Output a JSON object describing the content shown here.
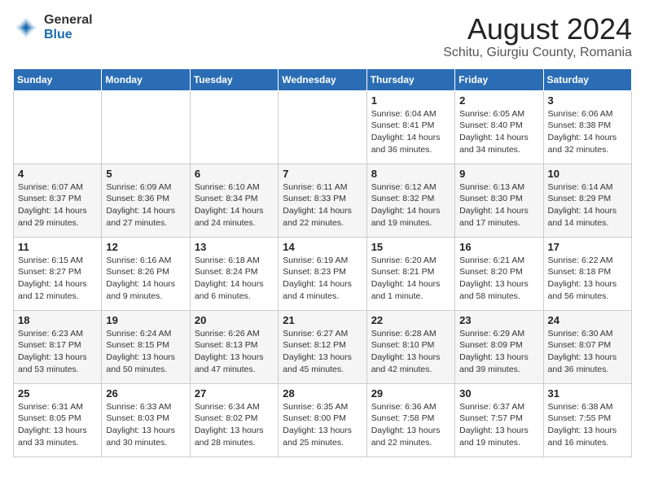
{
  "logo": {
    "general": "General",
    "blue": "Blue"
  },
  "title": "August 2024",
  "subtitle": "Schitu, Giurgiu County, Romania",
  "weekdays": [
    "Sunday",
    "Monday",
    "Tuesday",
    "Wednesday",
    "Thursday",
    "Friday",
    "Saturday"
  ],
  "weeks": [
    [
      {
        "day": "",
        "info": ""
      },
      {
        "day": "",
        "info": ""
      },
      {
        "day": "",
        "info": ""
      },
      {
        "day": "",
        "info": ""
      },
      {
        "day": "1",
        "info": "Sunrise: 6:04 AM\nSunset: 8:41 PM\nDaylight: 14 hours\nand 36 minutes."
      },
      {
        "day": "2",
        "info": "Sunrise: 6:05 AM\nSunset: 8:40 PM\nDaylight: 14 hours\nand 34 minutes."
      },
      {
        "day": "3",
        "info": "Sunrise: 6:06 AM\nSunset: 8:38 PM\nDaylight: 14 hours\nand 32 minutes."
      }
    ],
    [
      {
        "day": "4",
        "info": "Sunrise: 6:07 AM\nSunset: 8:37 PM\nDaylight: 14 hours\nand 29 minutes."
      },
      {
        "day": "5",
        "info": "Sunrise: 6:09 AM\nSunset: 8:36 PM\nDaylight: 14 hours\nand 27 minutes."
      },
      {
        "day": "6",
        "info": "Sunrise: 6:10 AM\nSunset: 8:34 PM\nDaylight: 14 hours\nand 24 minutes."
      },
      {
        "day": "7",
        "info": "Sunrise: 6:11 AM\nSunset: 8:33 PM\nDaylight: 14 hours\nand 22 minutes."
      },
      {
        "day": "8",
        "info": "Sunrise: 6:12 AM\nSunset: 8:32 PM\nDaylight: 14 hours\nand 19 minutes."
      },
      {
        "day": "9",
        "info": "Sunrise: 6:13 AM\nSunset: 8:30 PM\nDaylight: 14 hours\nand 17 minutes."
      },
      {
        "day": "10",
        "info": "Sunrise: 6:14 AM\nSunset: 8:29 PM\nDaylight: 14 hours\nand 14 minutes."
      }
    ],
    [
      {
        "day": "11",
        "info": "Sunrise: 6:15 AM\nSunset: 8:27 PM\nDaylight: 14 hours\nand 12 minutes."
      },
      {
        "day": "12",
        "info": "Sunrise: 6:16 AM\nSunset: 8:26 PM\nDaylight: 14 hours\nand 9 minutes."
      },
      {
        "day": "13",
        "info": "Sunrise: 6:18 AM\nSunset: 8:24 PM\nDaylight: 14 hours\nand 6 minutes."
      },
      {
        "day": "14",
        "info": "Sunrise: 6:19 AM\nSunset: 8:23 PM\nDaylight: 14 hours\nand 4 minutes."
      },
      {
        "day": "15",
        "info": "Sunrise: 6:20 AM\nSunset: 8:21 PM\nDaylight: 14 hours\nand 1 minute."
      },
      {
        "day": "16",
        "info": "Sunrise: 6:21 AM\nSunset: 8:20 PM\nDaylight: 13 hours\nand 58 minutes."
      },
      {
        "day": "17",
        "info": "Sunrise: 6:22 AM\nSunset: 8:18 PM\nDaylight: 13 hours\nand 56 minutes."
      }
    ],
    [
      {
        "day": "18",
        "info": "Sunrise: 6:23 AM\nSunset: 8:17 PM\nDaylight: 13 hours\nand 53 minutes."
      },
      {
        "day": "19",
        "info": "Sunrise: 6:24 AM\nSunset: 8:15 PM\nDaylight: 13 hours\nand 50 minutes."
      },
      {
        "day": "20",
        "info": "Sunrise: 6:26 AM\nSunset: 8:13 PM\nDaylight: 13 hours\nand 47 minutes."
      },
      {
        "day": "21",
        "info": "Sunrise: 6:27 AM\nSunset: 8:12 PM\nDaylight: 13 hours\nand 45 minutes."
      },
      {
        "day": "22",
        "info": "Sunrise: 6:28 AM\nSunset: 8:10 PM\nDaylight: 13 hours\nand 42 minutes."
      },
      {
        "day": "23",
        "info": "Sunrise: 6:29 AM\nSunset: 8:09 PM\nDaylight: 13 hours\nand 39 minutes."
      },
      {
        "day": "24",
        "info": "Sunrise: 6:30 AM\nSunset: 8:07 PM\nDaylight: 13 hours\nand 36 minutes."
      }
    ],
    [
      {
        "day": "25",
        "info": "Sunrise: 6:31 AM\nSunset: 8:05 PM\nDaylight: 13 hours\nand 33 minutes."
      },
      {
        "day": "26",
        "info": "Sunrise: 6:33 AM\nSunset: 8:03 PM\nDaylight: 13 hours\nand 30 minutes."
      },
      {
        "day": "27",
        "info": "Sunrise: 6:34 AM\nSunset: 8:02 PM\nDaylight: 13 hours\nand 28 minutes."
      },
      {
        "day": "28",
        "info": "Sunrise: 6:35 AM\nSunset: 8:00 PM\nDaylight: 13 hours\nand 25 minutes."
      },
      {
        "day": "29",
        "info": "Sunrise: 6:36 AM\nSunset: 7:58 PM\nDaylight: 13 hours\nand 22 minutes."
      },
      {
        "day": "30",
        "info": "Sunrise: 6:37 AM\nSunset: 7:57 PM\nDaylight: 13 hours\nand 19 minutes."
      },
      {
        "day": "31",
        "info": "Sunrise: 6:38 AM\nSunset: 7:55 PM\nDaylight: 13 hours\nand 16 minutes."
      }
    ]
  ]
}
